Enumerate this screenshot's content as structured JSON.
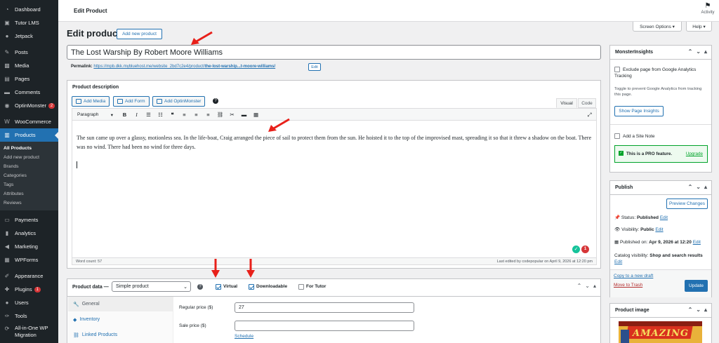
{
  "sidebar": {
    "items_top": [
      {
        "label": "Dashboard",
        "icon": "dashboard-icon"
      },
      {
        "label": "Tutor LMS",
        "icon": "tutor-icon"
      },
      {
        "label": "Jetpack",
        "icon": "jetpack-icon"
      }
    ],
    "items_mid": [
      {
        "label": "Posts",
        "icon": "pin-icon"
      },
      {
        "label": "Media",
        "icon": "media-icon"
      },
      {
        "label": "Pages",
        "icon": "page-icon"
      },
      {
        "label": "Comments",
        "icon": "comment-icon"
      },
      {
        "label": "OptinMonster",
        "icon": "optinmonster-icon",
        "badge": "2"
      }
    ],
    "items_woo": [
      {
        "label": "WooCommerce",
        "icon": "woo-icon"
      },
      {
        "label": "Products",
        "icon": "products-icon"
      }
    ],
    "submenu": [
      "All Products",
      "Add new product",
      "Brands",
      "Categories",
      "Tags",
      "Attributes",
      "Reviews"
    ],
    "items_bottom": [
      {
        "label": "Payments",
        "icon": "payments-icon"
      },
      {
        "label": "Analytics",
        "icon": "analytics-icon"
      },
      {
        "label": "Marketing",
        "icon": "marketing-icon"
      },
      {
        "label": "WPForms",
        "icon": "wpforms-icon"
      }
    ],
    "items_last": [
      {
        "label": "Appearance",
        "icon": "brush-icon"
      },
      {
        "label": "Plugins",
        "icon": "plugin-icon",
        "badge": "1"
      },
      {
        "label": "Users",
        "icon": "user-icon"
      },
      {
        "label": "Tools",
        "icon": "wrench-icon"
      },
      {
        "label": "All-in-One WP",
        "label2": "Migration",
        "icon": "migration-icon"
      }
    ]
  },
  "topbar": {
    "title": "Edit Product",
    "activity": "Activity"
  },
  "screen_options": "Screen Options ▾",
  "help": "Help ▾",
  "page": {
    "heading": "Edit product",
    "add_new": "Add new product",
    "title_value": "The Lost Warship By Robert Moore Williams",
    "permalink_label": "Permalink:",
    "permalink_url": "https://mpb.dkk.mybluehost.me/website_2bd7c2e4/product/",
    "permalink_slug": "the-lost-warship...t-moore-williams/",
    "permalink_edit": "Edit"
  },
  "description": {
    "title": "Product description",
    "add_media": "Add Media",
    "add_form": "Add Form",
    "add_optin": "Add OptinMonster",
    "tab_visual": "Visual",
    "tab_code": "Code",
    "paragraph": "Paragraph",
    "content": "The sun came up over a glassy, motionless sea. In the life-boat, Craig arranged the piece of sail to protect them from the sun. He hoisted it to the top of the improvised mast, spreading it so that it threw a shadow on the boat. There was no wind. There had been no wind for three days.",
    "word_count": "Word count: 57",
    "last_edited": "Last edited by codepopular on April 9, 2026 at 12:20 pm",
    "grammarly_count": "1"
  },
  "product_data": {
    "label": "Product data —",
    "type": "Simple product",
    "virtual": "Virtual",
    "downloadable": "Downloadable",
    "for_tutor": "For Tutor",
    "tabs": [
      "General",
      "Inventory",
      "Linked Products"
    ],
    "regular_price_label": "Regular price ($)",
    "regular_price": "27",
    "sale_price_label": "Sale price ($)",
    "sale_price": "",
    "schedule": "Schedule"
  },
  "monsterinsights": {
    "title": "MonsterInsights",
    "exclude": "Exclude page from Google Analytics Tracking",
    "toggle_help": "Toggle to prevent Google Analytics from tracking this page.",
    "show_insights": "Show Page Insights",
    "site_note": "Add a Site Note",
    "pro": "This is a PRO feature.",
    "upgrade": "Upgrade"
  },
  "publish": {
    "title": "Publish",
    "preview": "Preview Changes",
    "status_label": "Status:",
    "status": "Published",
    "visibility_label": "Visibility:",
    "visibility": "Public",
    "published_label": "Published on:",
    "published": "Apr 9, 2026 at 12:20",
    "catalog_label": "Catalog visibility:",
    "catalog": "Shop and search results",
    "edit": "Edit",
    "copy_draft": "Copy to a new draft",
    "trash": "Move to Trash",
    "update": "Update"
  },
  "product_image": {
    "title": "Product image",
    "cover_text": "AMAZING"
  },
  "colors": {
    "accent": "#2271b1",
    "sidebar": "#1d2327",
    "annotation_arrow": "#e8201a",
    "pro_green": "#00a32a"
  }
}
